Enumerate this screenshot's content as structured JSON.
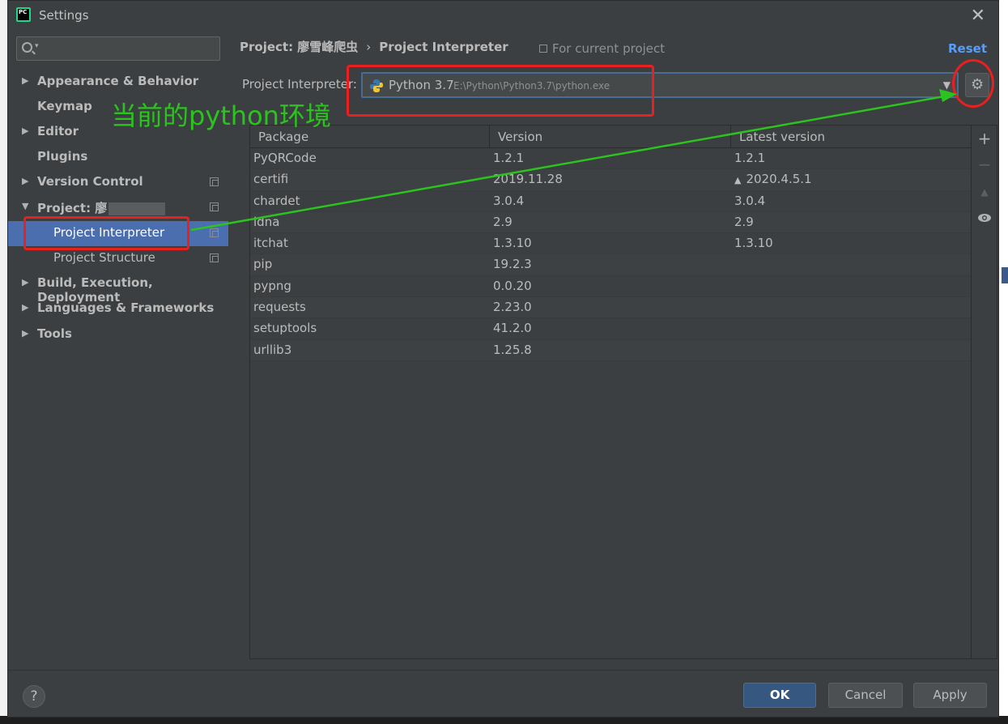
{
  "window": {
    "title": "Settings",
    "app_icon_text": "PC",
    "close_label": "✕"
  },
  "sidebar": {
    "search_placeholder": "",
    "items": [
      {
        "label": "Appearance & Behavior",
        "arrow": "▶"
      },
      {
        "label": "Keymap"
      },
      {
        "label": "Editor",
        "arrow": "▶"
      },
      {
        "label": "Plugins"
      },
      {
        "label": "Version Control",
        "arrow": "▶"
      },
      {
        "label": "Project: 廖",
        "arrow": "▼"
      },
      {
        "label": "Project Interpreter"
      },
      {
        "label": "Project Structure"
      },
      {
        "label": "Build, Execution, Deployment",
        "arrow": "▶"
      },
      {
        "label": "Languages & Frameworks",
        "arrow": "▶"
      },
      {
        "label": "Tools",
        "arrow": "▶"
      }
    ]
  },
  "main": {
    "breadcrumb": {
      "project": "Project: 廖雪峰爬虫",
      "separator": "›",
      "page": "Project Interpreter"
    },
    "for_current_project": "For current project",
    "reset_label": "Reset",
    "interpreter": {
      "label": "Project Interpreter:",
      "name": "Python 3.7",
      "path": "E:\\Python\\Python3.7\\python.exe"
    },
    "table": {
      "columns": [
        "Package",
        "Version",
        "Latest version"
      ],
      "rows": [
        {
          "package": "PyQRCode",
          "version": "1.2.1",
          "latest": "1.2.1",
          "upgrade": false
        },
        {
          "package": "certifi",
          "version": "2019.11.28",
          "latest": "2020.4.5.1",
          "upgrade": true
        },
        {
          "package": "chardet",
          "version": "3.0.4",
          "latest": "3.0.4",
          "upgrade": false
        },
        {
          "package": "idna",
          "version": "2.9",
          "latest": "2.9",
          "upgrade": false
        },
        {
          "package": "itchat",
          "version": "1.3.10",
          "latest": "1.3.10",
          "upgrade": false
        },
        {
          "package": "pip",
          "version": "19.2.3",
          "latest": "",
          "upgrade": false
        },
        {
          "package": "pypng",
          "version": "0.0.20",
          "latest": "",
          "upgrade": false
        },
        {
          "package": "requests",
          "version": "2.23.0",
          "latest": "",
          "upgrade": false
        },
        {
          "package": "setuptools",
          "version": "41.2.0",
          "latest": "",
          "upgrade": false
        },
        {
          "package": "urllib3",
          "version": "1.25.8",
          "latest": "",
          "upgrade": false
        }
      ]
    },
    "tools": {
      "add": "+",
      "remove": "−",
      "upgrade": "▲",
      "show": "👁"
    }
  },
  "footer": {
    "help_label": "?",
    "ok_label": "OK",
    "cancel_label": "Cancel",
    "apply_label": "Apply"
  },
  "annotation": {
    "text": "当前的python环境",
    "color": "#2cc31e",
    "box_color": "#e8201f"
  },
  "colors": {
    "background": "#3c3f41",
    "selection": "#4b6eaf",
    "link": "#589df6",
    "primary_button": "#365880"
  }
}
